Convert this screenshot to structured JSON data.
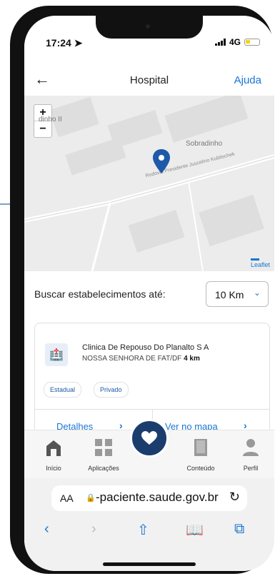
{
  "status": {
    "time": "17:24",
    "network": "4G"
  },
  "header": {
    "title": "Hospital",
    "help": "Ajuda"
  },
  "map": {
    "labels": [
      "dinho II",
      "Sobradinho"
    ],
    "road": "Rodovia Presidente Juscelino Kubitschek",
    "attribution": "Leaflet",
    "zoom_in": "+",
    "zoom_out": "−"
  },
  "search": {
    "label": "Buscar estabelecimentos até:",
    "radius": "10 Km"
  },
  "result": {
    "name": "Clinica De Repouso Do Planalto S A",
    "address": "NOSSA SENHORA DE FAT/DF",
    "distance": "4 km",
    "tags": [
      "Estadual",
      "Privado"
    ],
    "details": "Detalhes",
    "map_link": "Ver no mapa"
  },
  "tabs": [
    {
      "label": "Início",
      "icon": "home-icon"
    },
    {
      "label": "Aplicações",
      "icon": "apps-icon"
    },
    {
      "label": "Conteúdo",
      "icon": "book-icon"
    },
    {
      "label": "Perfil",
      "icon": "profile-icon"
    }
  ],
  "browser": {
    "aa": "AA",
    "url": "-paciente.saude.gov.br"
  },
  "colors": {
    "accent": "#1976d2",
    "fab": "#1b3d6e",
    "pin": "#1e5aa8"
  }
}
